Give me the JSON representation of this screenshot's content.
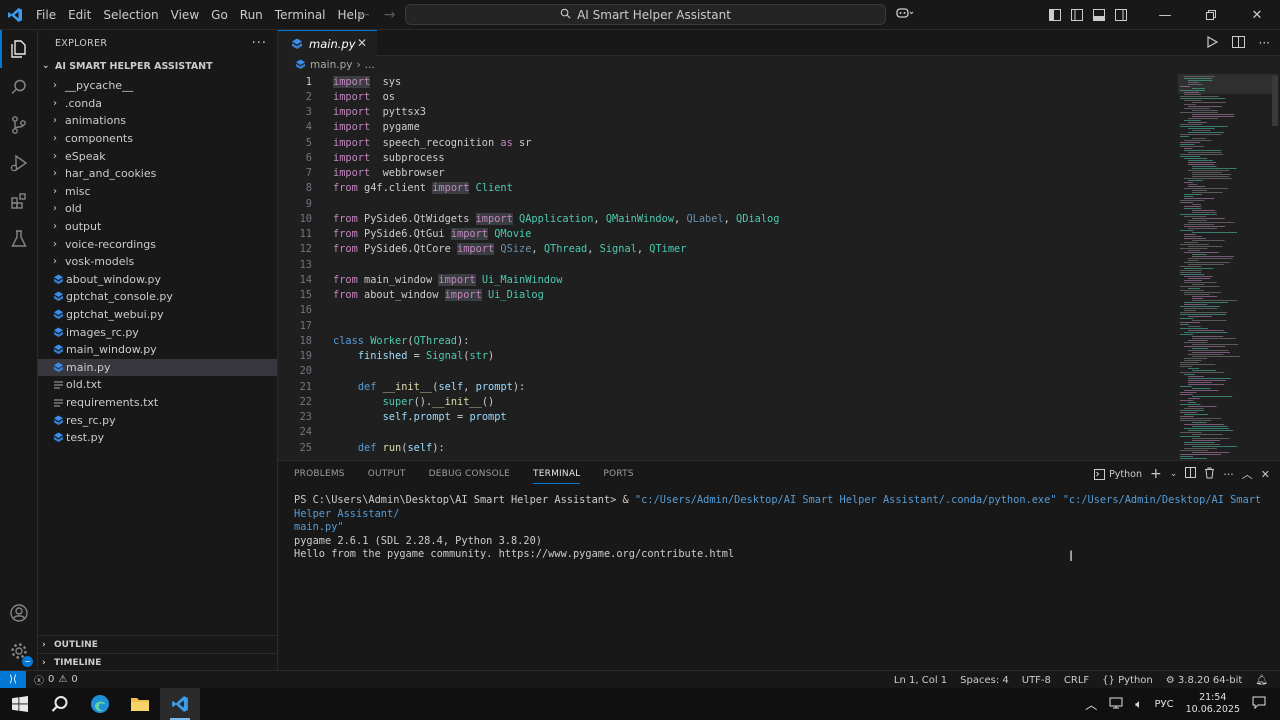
{
  "window": {
    "title": "AI Smart Helper Assistant",
    "menu": [
      "File",
      "Edit",
      "Selection",
      "View",
      "Go",
      "Run",
      "Terminal",
      "Help"
    ]
  },
  "explorer": {
    "header": "EXPLORER",
    "root": "AI SMART HELPER ASSISTANT",
    "folders": [
      "__pycache__",
      ".conda",
      "animations",
      "components",
      "eSpeak",
      "har_and_cookies",
      "misc",
      "old",
      "output",
      "voice-recordings",
      "vosk-models"
    ],
    "files": [
      {
        "name": "about_window.py",
        "type": "py"
      },
      {
        "name": "gptchat_console.py",
        "type": "py"
      },
      {
        "name": "gptchat_webui.py",
        "type": "py"
      },
      {
        "name": "images_rc.py",
        "type": "py"
      },
      {
        "name": "main_window.py",
        "type": "py"
      },
      {
        "name": "main.py",
        "type": "py",
        "selected": true
      },
      {
        "name": "old.txt",
        "type": "txt"
      },
      {
        "name": "requirements.txt",
        "type": "txt"
      },
      {
        "name": "res_rc.py",
        "type": "py"
      },
      {
        "name": "test.py",
        "type": "py"
      }
    ],
    "outline": "OUTLINE",
    "timeline": "TIMELINE"
  },
  "editor": {
    "tab": "main.py",
    "breadcrumb_file": "main.py",
    "breadcrumb_more": "...",
    "lines": [
      [
        [
          "kw2 hl",
          "import"
        ],
        [
          "",
          "  sys"
        ]
      ],
      [
        [
          "kw2",
          "import"
        ],
        [
          "",
          "  os"
        ]
      ],
      [
        [
          "kw2",
          "import"
        ],
        [
          "",
          "  pyttsx3"
        ]
      ],
      [
        [
          "kw2",
          "import"
        ],
        [
          "",
          "  pygame"
        ]
      ],
      [
        [
          "kw2",
          "import"
        ],
        [
          "",
          "  speech_recognition "
        ],
        [
          "kw2",
          "as"
        ],
        [
          "",
          " sr"
        ]
      ],
      [
        [
          "kw2",
          "import"
        ],
        [
          "",
          "  subprocess"
        ]
      ],
      [
        [
          "kw2",
          "import"
        ],
        [
          "",
          "  webbrowser"
        ]
      ],
      [
        [
          "kw2",
          "from"
        ],
        [
          "",
          " g4f.client "
        ],
        [
          "kw2 hl",
          "import"
        ],
        [
          "",
          " "
        ],
        [
          "ty",
          "Client"
        ]
      ],
      [],
      [
        [
          "kw2",
          "from"
        ],
        [
          "",
          " PySide6.QtWidgets "
        ],
        [
          "kw2 hl",
          "import"
        ],
        [
          "",
          " "
        ],
        [
          "ty",
          "QApplication"
        ],
        [
          "",
          ", "
        ],
        [
          "ty",
          "QMainWindow"
        ],
        [
          "",
          ", "
        ],
        [
          "dim",
          "QLabel"
        ],
        [
          "",
          ", "
        ],
        [
          "ty",
          "QDialog"
        ]
      ],
      [
        [
          "kw2",
          "from"
        ],
        [
          "",
          " PySide6.QtGui "
        ],
        [
          "kw2 hl",
          "import"
        ],
        [
          "",
          " "
        ],
        [
          "ty",
          "QMovie"
        ]
      ],
      [
        [
          "kw2",
          "from"
        ],
        [
          "",
          " PySide6.QtCore "
        ],
        [
          "kw2 hl",
          "import"
        ],
        [
          "",
          " "
        ],
        [
          "dim",
          "QSize"
        ],
        [
          "",
          ", "
        ],
        [
          "ty",
          "QThread"
        ],
        [
          "",
          ", "
        ],
        [
          "ty",
          "Signal"
        ],
        [
          "",
          ", "
        ],
        [
          "ty",
          "QTimer"
        ]
      ],
      [],
      [
        [
          "kw2",
          "from"
        ],
        [
          "",
          " main_window "
        ],
        [
          "kw2 hl",
          "import"
        ],
        [
          "",
          " "
        ],
        [
          "ty",
          "Ui_MainWindow"
        ]
      ],
      [
        [
          "kw2",
          "from"
        ],
        [
          "",
          " about_window "
        ],
        [
          "kw2 hl",
          "import"
        ],
        [
          "",
          " "
        ],
        [
          "ty",
          "Ui_Dialog"
        ]
      ],
      [],
      [],
      [
        [
          "kw",
          "class"
        ],
        [
          "",
          " "
        ],
        [
          "ty",
          "Worker"
        ],
        [
          "",
          "("
        ],
        [
          "ty",
          "QThread"
        ],
        [
          "",
          "):"
        ]
      ],
      [
        [
          "",
          "    "
        ],
        [
          "va",
          "finished"
        ],
        [
          "",
          " = "
        ],
        [
          "ty",
          "Signal"
        ],
        [
          "",
          "("
        ],
        [
          "ty",
          "str"
        ],
        [
          "",
          ")"
        ]
      ],
      [],
      [
        [
          "",
          "    "
        ],
        [
          "kw",
          "def"
        ],
        [
          "",
          " "
        ],
        [
          "fn",
          "__init__"
        ],
        [
          "",
          "("
        ],
        [
          "va",
          "self"
        ],
        [
          "",
          ", "
        ],
        [
          "va",
          "prompt"
        ],
        [
          "",
          "):"
        ]
      ],
      [
        [
          "",
          "        "
        ],
        [
          "ty",
          "super"
        ],
        [
          "",
          "()."
        ],
        [
          "fn",
          "__init__"
        ],
        [
          "",
          "()"
        ]
      ],
      [
        [
          "",
          "        "
        ],
        [
          "va",
          "self"
        ],
        [
          "",
          "."
        ],
        [
          "va",
          "prompt"
        ],
        [
          "",
          " = "
        ],
        [
          "va",
          "prompt"
        ]
      ],
      [],
      [
        [
          "",
          "    "
        ],
        [
          "kw",
          "def"
        ],
        [
          "",
          " "
        ],
        [
          "fn",
          "run"
        ],
        [
          "",
          "("
        ],
        [
          "va",
          "self"
        ],
        [
          "",
          "):"
        ]
      ]
    ]
  },
  "panel": {
    "tabs": [
      "PROBLEMS",
      "OUTPUT",
      "DEBUG CONSOLE",
      "TERMINAL",
      "PORTS"
    ],
    "active_tab": "TERMINAL",
    "shell": "Python",
    "terminal_prompt": "PS C:\\Users\\Admin\\Desktop\\AI Smart Helper Assistant> & ",
    "terminal_cmd_1": "\"c:/Users/Admin/Desktop/AI Smart Helper Assistant/.conda/python.exe\"",
    "terminal_cmd_2": " \"c:/Users/Admin/Desktop/AI Smart Helper Assistant/",
    "terminal_cmd_3": "main.py\"",
    "terminal_out_1": "pygame 2.6.1 (SDL 2.28.4, Python 3.8.20)",
    "terminal_out_2": "Hello from the pygame community. https://www.pygame.org/contribute.html"
  },
  "status": {
    "errors": "0",
    "warnings": "0",
    "position": "Ln 1, Col 1",
    "spaces": "Spaces: 4",
    "encoding": "UTF-8",
    "eol": "CRLF",
    "language": "Python",
    "interpreter": "3.8.20 64-bit"
  },
  "taskbar": {
    "lang": "РУС",
    "time": "21:54",
    "date": "10.06.2025"
  },
  "colors": {
    "accent": "#0078d4",
    "keyword": "#569cd6",
    "control_keyword": "#c586c0",
    "type": "#4ec9b0",
    "function": "#dcdcaa",
    "variable": "#9cdcfe",
    "python_icon": "#3b8eea"
  }
}
